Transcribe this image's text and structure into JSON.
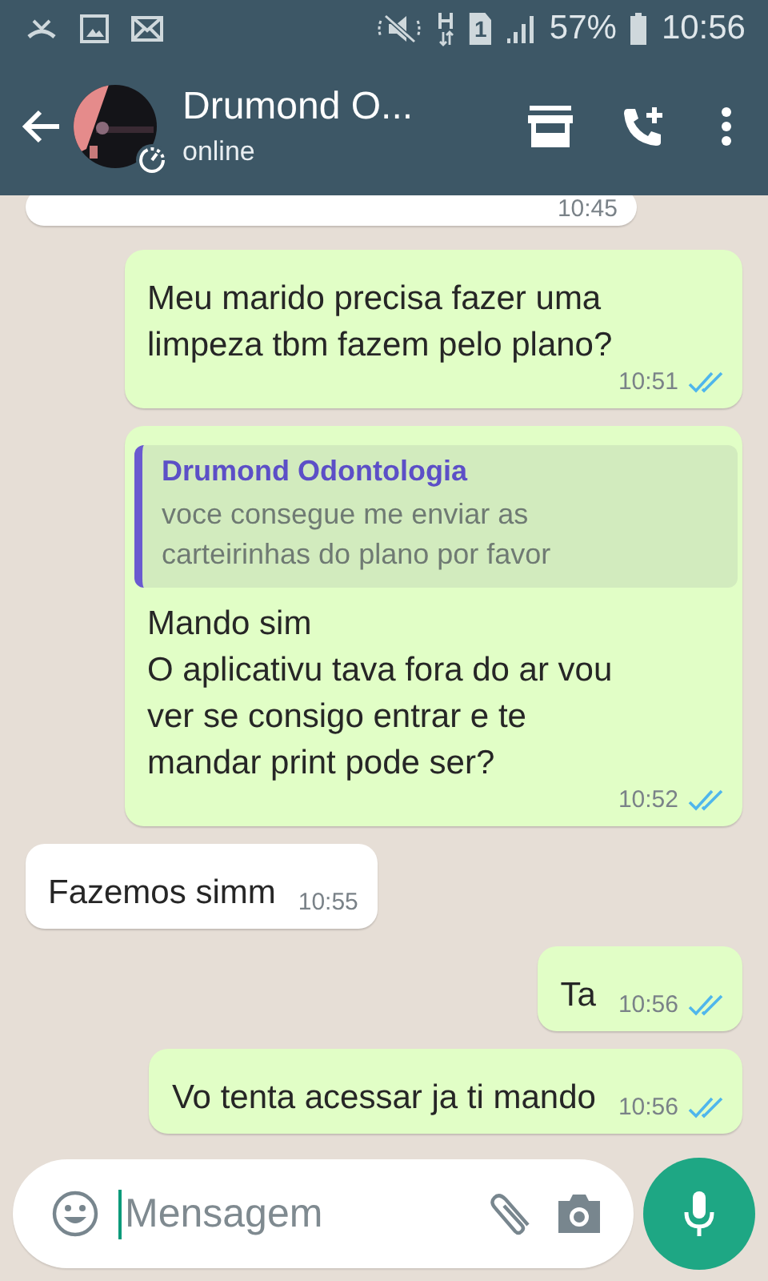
{
  "status_bar": {
    "sim_label": "1",
    "battery": "57%",
    "time": "10:56"
  },
  "header": {
    "title": "Drumond O...",
    "subtitle": "online"
  },
  "messages": [
    {
      "kind": "received",
      "time": "10:45"
    },
    {
      "kind": "sent",
      "text": "Meu marido precisa fazer uma\nlimpeza tbm fazem pelo plano?",
      "time": "10:51",
      "read": true
    },
    {
      "kind": "sent",
      "quote": {
        "author": "Drumond Odontologia",
        "text": "voce consegue me enviar as\ncarteirinhas do plano por favor"
      },
      "text": "Mando sim\nO aplicativu tava fora do ar vou\nver se consigo entrar e te\nmandar print pode ser?",
      "time": "10:52",
      "read": true
    },
    {
      "kind": "received",
      "text": "Fazemos simm",
      "time": "10:55"
    },
    {
      "kind": "sent",
      "text": "Ta",
      "time": "10:56",
      "read": true
    },
    {
      "kind": "sent",
      "text": "Vo tenta acessar ja ti mando",
      "time": "10:56",
      "read": true
    }
  ],
  "composer": {
    "placeholder": "Mensagem"
  }
}
